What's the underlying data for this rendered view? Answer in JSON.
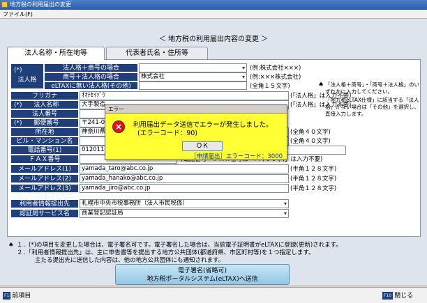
{
  "window": {
    "title": "地方税の利用届出の変更"
  },
  "menu": {
    "file": "ファイル(F)"
  },
  "page": {
    "title": "＜ 地方税の利用届出内容の変更 ＞"
  },
  "tabs": [
    {
      "label": "法人名称・所在地等",
      "active": true
    },
    {
      "label": "代表者氏名・住所等",
      "active": false
    }
  ],
  "form": {
    "houjinkaku_label": "法人格",
    "houjinkaku_marker": "(*)",
    "opt1_label": "法人格＋商号の場合",
    "opt1_value": "",
    "opt1_hint": "(例:株式会社×××)",
    "opt2_label": "商号＋法人格の場合",
    "opt2_value": "株式会社",
    "opt2_hint": "(例:×××株式会社)",
    "opt3_label": "eLTAXに無い法人格(その他)",
    "opt3_value": "",
    "opt3_hint": "(全角１５文字)",
    "furigana_label": "フリガナ",
    "furigana_value": "ｵｵﾃｾｲｿﾞｳ",
    "furigana_hint": "(「法人格」は入力不要)",
    "name_marker": "(*)",
    "name_label": "法人名称",
    "name_value": "大手製造",
    "name_hint": "(「法人格」は入力不要)",
    "number_label": "法人番号",
    "number_value": "",
    "zip_marker": "(*)",
    "zip_label": "郵便番号",
    "zip_value": "〒241-00",
    "address_label": "所在地",
    "address_value": "神奈川県",
    "address_hint": "(全角４０文字)",
    "building_label": "ビル・マンション名",
    "building_value": "",
    "building_hint": "(全角４０文字)",
    "tel_label": "電話番号(1)",
    "tel_value": "012011111",
    "fax_label": "ＦＡＸ番号",
    "fax_value": "",
    "tel_fax_hint": "(電話番号・ＦＡＸ番号は「ハイフン(-)」は入力不要)",
    "email1_label": "メールアドレス(1)",
    "email1_value": "yamada_taro@abc.co.jp",
    "email2_label": "メールアドレス(2)",
    "email2_value": "yamada_hanako@abc.co.jp",
    "email3_label": "メールアドレス(3)",
    "email3_value": "yamada_jiro@abc.co.jp",
    "email_hint": "(半角１２８文字)",
    "provider_label": "利用者情報提出先",
    "provider_value": "札幌市中央市税事務所（法人市民税係）",
    "cert_label": "認証局サービス名",
    "cert_value": "商業登記認証局"
  },
  "side_note": {
    "line1": "「法人格＋商号」・「商号＋法人格」のいずれかに入力してください。",
    "line2": "「地方税eLTAX仕様」に該当する「法人格」がない場合は「その他」を選択し、直接入力します。"
  },
  "notes": {
    "line1": "１．(*)の項目を変更した場合は、電子署名可です。電子署名した場合は、当該電子証明書がeLTAXに登録(更新)されます。",
    "line2": "２．「利用者情報提出先」は、主に申告書等を提出する地方公共団体(都道府県、市区町村等)を１つ指定します。",
    "line3": "主たる提出先に送信した内容は、他の地方公共団体にも通知されます。"
  },
  "submit": {
    "line1": "電子署名(省略可)",
    "line2": "地方税ポータルシステム(eLTAX)へ送信"
  },
  "statusbar": {
    "f1_key": "F1",
    "f1_label": "前項目",
    "f10_key": "F10",
    "f10_label": "閉じる"
  },
  "dialog": {
    "title": "エラー",
    "message1": "利用届出データ送信でエラーが発生しました。",
    "message2": "(エラーコード：90)",
    "ok_label": "ＯＫ",
    "footer": "［申請届出］エラーコード：3000",
    "icon": "error-x-icon"
  }
}
